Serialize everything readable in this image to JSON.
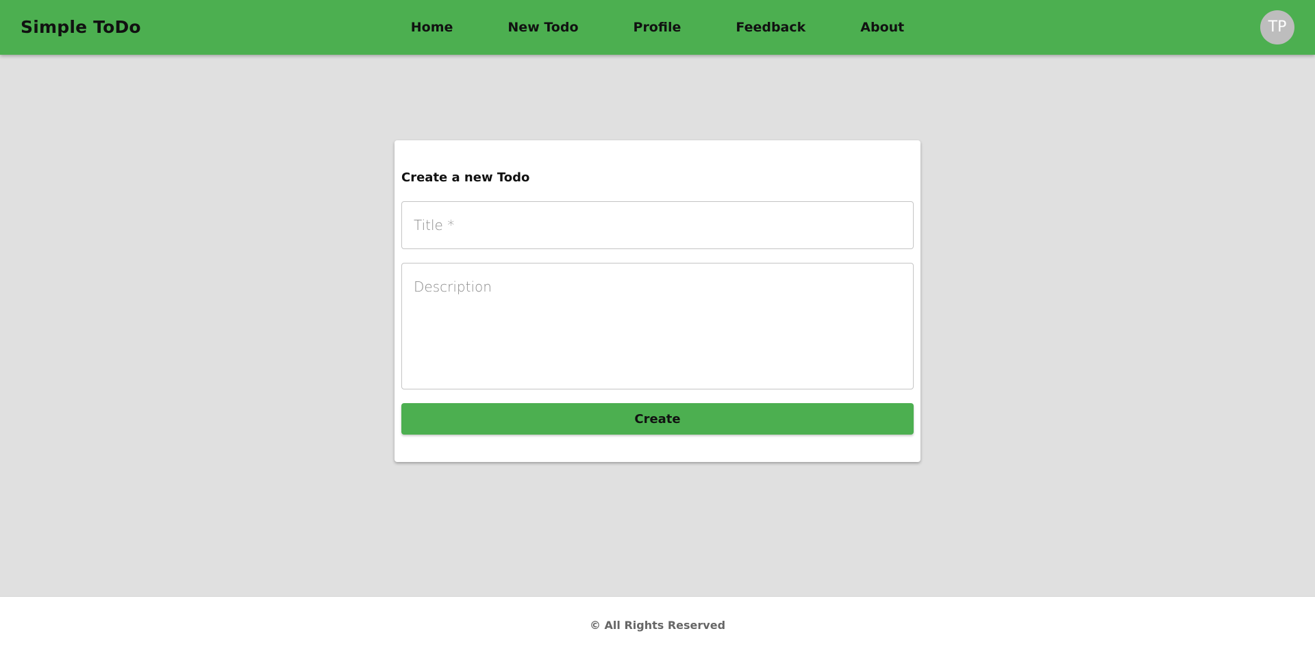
{
  "app": {
    "brand": "Simple ToDo",
    "accent_color": "#4caf50"
  },
  "nav": {
    "items": [
      {
        "label": "Home"
      },
      {
        "label": "New Todo"
      },
      {
        "label": "Profile"
      },
      {
        "label": "Feedback"
      },
      {
        "label": "About"
      }
    ]
  },
  "user": {
    "initials": "TP"
  },
  "form": {
    "heading": "Create a new Todo",
    "title_field": {
      "value": "",
      "placeholder": "Title *"
    },
    "description_field": {
      "value": "",
      "placeholder": "Description"
    },
    "submit_label": "Create"
  },
  "footer": {
    "text": "© All Rights Reserved"
  }
}
